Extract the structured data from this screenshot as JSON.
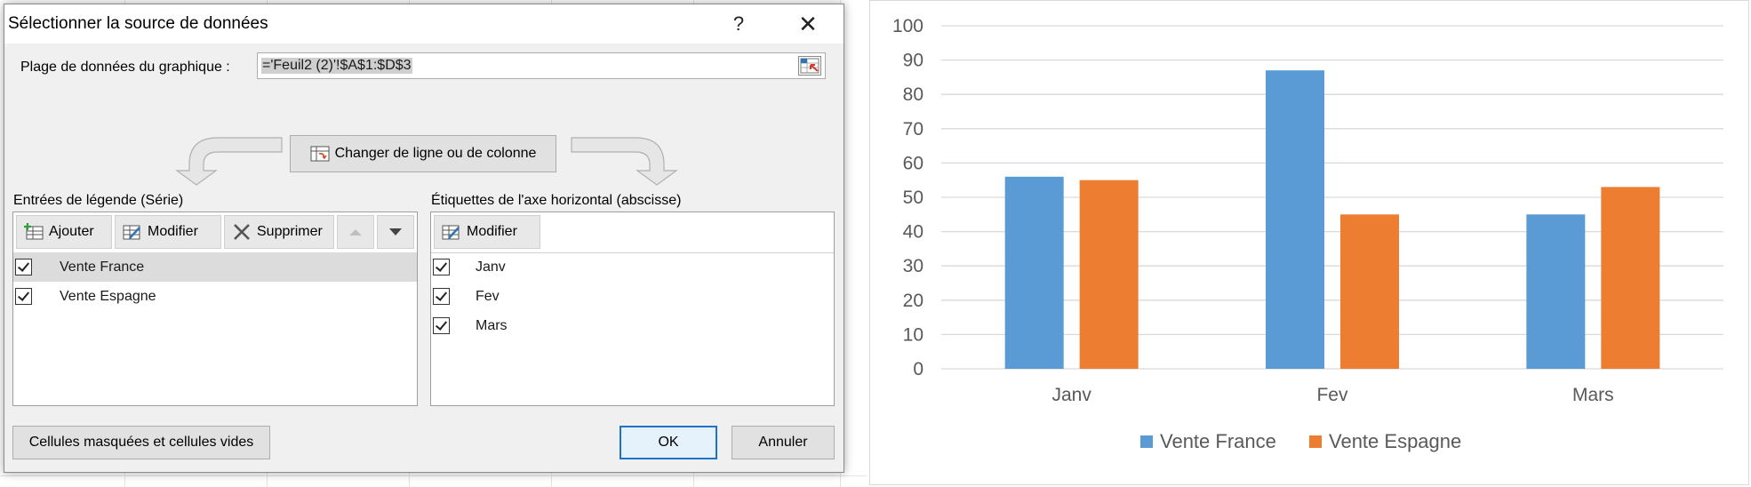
{
  "dialog": {
    "title": "Sélectionner la source de données",
    "help": "?",
    "close": "✕",
    "range_label": "Plage de données du graphique :",
    "range_value": "='Feuil2 (2)'!$A$1:$D$3",
    "switch_button": "Changer de ligne ou de colonne",
    "legend_section_label": "Entrées de légende (Série)",
    "axis_section_label": "Étiquettes de l'axe horizontal (abscisse)",
    "series_toolbar": {
      "add": "Ajouter",
      "edit": "Modifier",
      "delete": "Supprimer"
    },
    "axis_toolbar": {
      "edit": "Modifier"
    },
    "series": [
      {
        "label": "Vente France",
        "checked": true,
        "selected": true
      },
      {
        "label": "Vente Espagne",
        "checked": true,
        "selected": false
      }
    ],
    "categories": [
      {
        "label": "Janv",
        "checked": true
      },
      {
        "label": "Fev",
        "checked": true
      },
      {
        "label": "Mars",
        "checked": true
      }
    ],
    "hidden_cells_button": "Cellules masquées et cellules vides",
    "ok_button": "OK",
    "cancel_button": "Annuler"
  },
  "chart_data": {
    "type": "bar",
    "categories": [
      "Janv",
      "Fev",
      "Mars"
    ],
    "series": [
      {
        "name": "Vente France",
        "values": [
          56,
          87,
          45
        ],
        "color": "#5b9bd5"
      },
      {
        "name": "Vente Espagne",
        "values": [
          55,
          45,
          53
        ],
        "color": "#ed7d31"
      }
    ],
    "ylim": [
      0,
      100
    ],
    "yticks": [
      "0",
      "10",
      "20",
      "30",
      "40",
      "50",
      "60",
      "70",
      "80",
      "90",
      "100"
    ],
    "grid": true,
    "legend_position": "bottom"
  }
}
